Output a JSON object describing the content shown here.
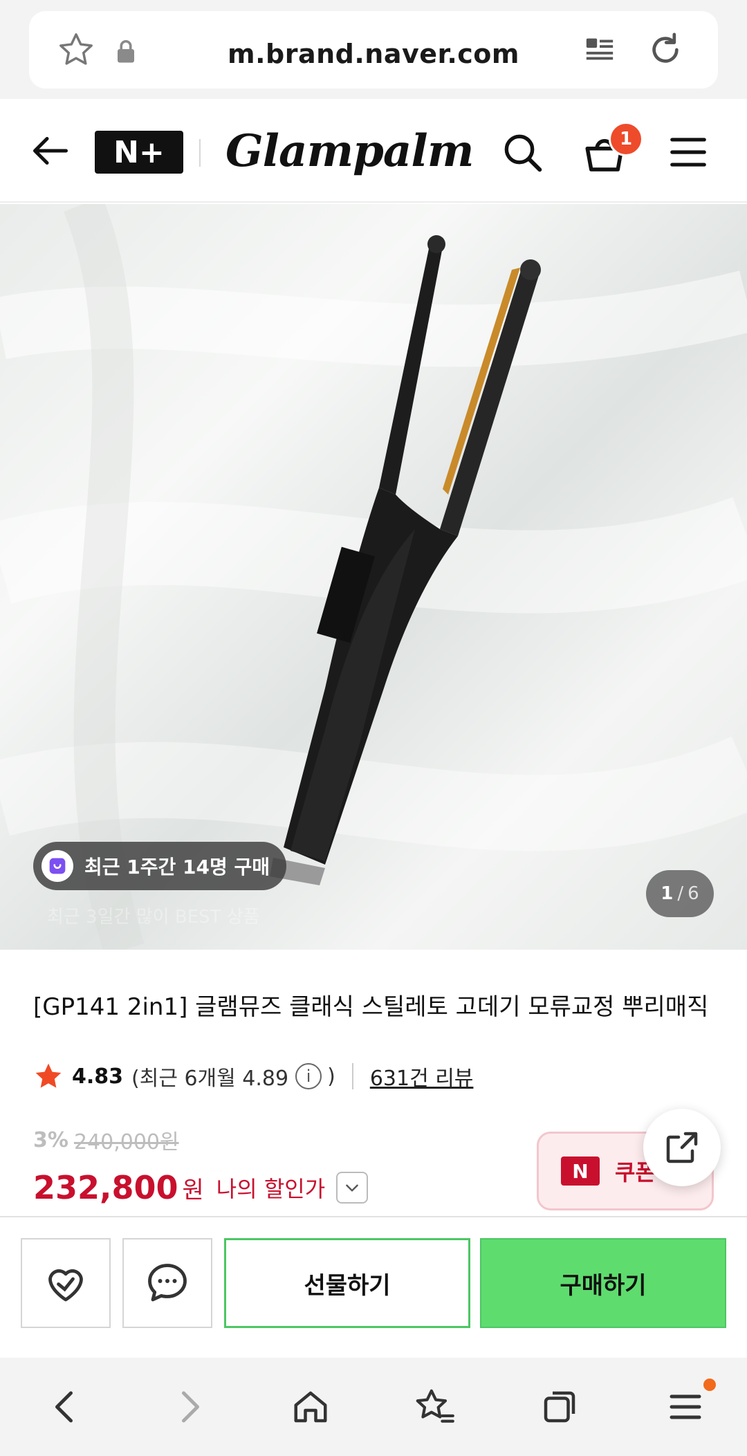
{
  "browser": {
    "url": "m.brand.naver.com"
  },
  "header": {
    "nplus_label": "N+",
    "brand_name": "Glampalm",
    "cart_count": "1"
  },
  "hero": {
    "recent_purchase": "최근 1주간 14명 구매",
    "ghost_text": "최근 3일간 많이 BEST 상품",
    "page_current": "1",
    "page_total": "6",
    "page_separator": "/"
  },
  "product": {
    "title": "[GP141 2in1] 글램뮤즈 클래식 스틸레토 고데기 모류교정 뿌리매직",
    "rating": "4.83",
    "recent_rating_open": "(최근 6개월 4.89",
    "recent_rating_close": ")",
    "review_count": "631건 리뷰",
    "discount_percent": "3%",
    "original_price": "240,000원",
    "sale_price": "232,800",
    "currency": "원",
    "my_discount_label": "나의 할인가"
  },
  "coupon": {
    "badge": "N",
    "label": "쿠폰"
  },
  "actions": {
    "gift_label": "선물하기",
    "buy_label": "구매하기"
  },
  "colors": {
    "price_red": "#c8102e",
    "buy_green": "#5fdc6e",
    "badge_orange": "#ee4b2b"
  }
}
